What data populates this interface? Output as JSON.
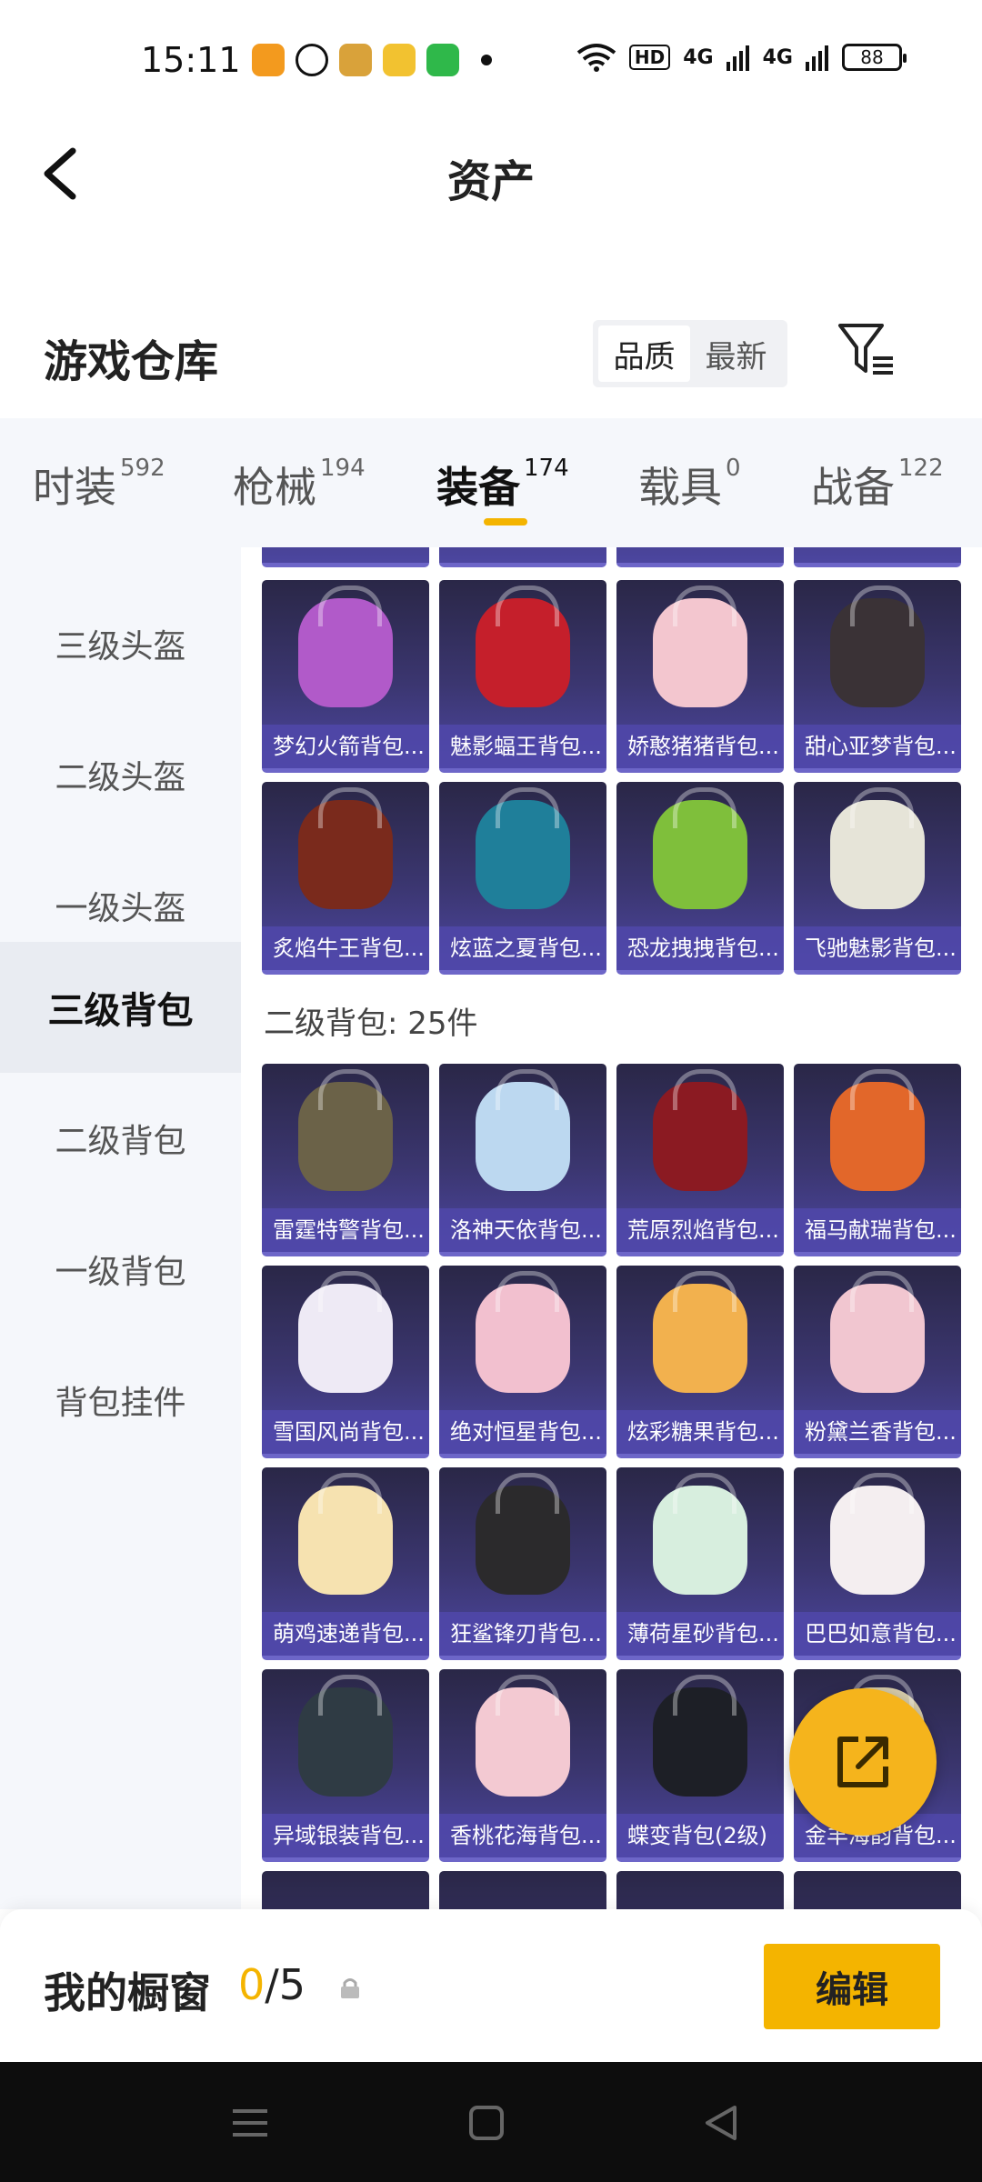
{
  "status": {
    "time": "15:11",
    "network": "4G",
    "network2": "4G",
    "hd": "HD",
    "battery": "88"
  },
  "header": {
    "title": "资产"
  },
  "warehouse": {
    "title": "游戏仓库",
    "sort": [
      "品质",
      "最新"
    ]
  },
  "tabs": [
    {
      "label": "时装",
      "count": "592"
    },
    {
      "label": "枪械",
      "count": "194"
    },
    {
      "label": "装备",
      "count": "174"
    },
    {
      "label": "载具",
      "count": "0"
    },
    {
      "label": "战备",
      "count": "122"
    }
  ],
  "sidebar": [
    "三级头盔",
    "二级头盔",
    "一级头盔",
    "三级背包",
    "二级背包",
    "一级背包",
    "背包挂件"
  ],
  "grid": {
    "top_rows": [
      [
        "梦幻火箭背包...",
        "魅影蝠王背包...",
        "娇憨猪猪背包...",
        "甜心亚梦背包..."
      ],
      [
        "炙焰牛王背包...",
        "炫蓝之夏背包...",
        "恐龙拽拽背包...",
        "飞驰魅影背包..."
      ]
    ],
    "section_title": "二级背包: 25件",
    "rows": [
      [
        "雷霆特警背包...",
        "洛神天依背包...",
        "荒原烈焰背包...",
        "福马献瑞背包..."
      ],
      [
        "雪国风尚背包...",
        "绝对恒星背包...",
        "炫彩糖果背包...",
        "粉黛兰香背包..."
      ],
      [
        "萌鸡速递背包...",
        "狂鲨锋刃背包...",
        "薄荷星砂背包...",
        "巴巴如意背包..."
      ],
      [
        "异域银装背包...",
        "香桃花海背包...",
        "蝶变背包(2级)",
        "金羊海韵背包..."
      ]
    ]
  },
  "showcase": {
    "title": "我的橱窗",
    "current": "0",
    "total": "/5",
    "edit_label": "编辑"
  },
  "colors": {
    "accent": "#f4b400",
    "card_bg": "#3b3670"
  }
}
